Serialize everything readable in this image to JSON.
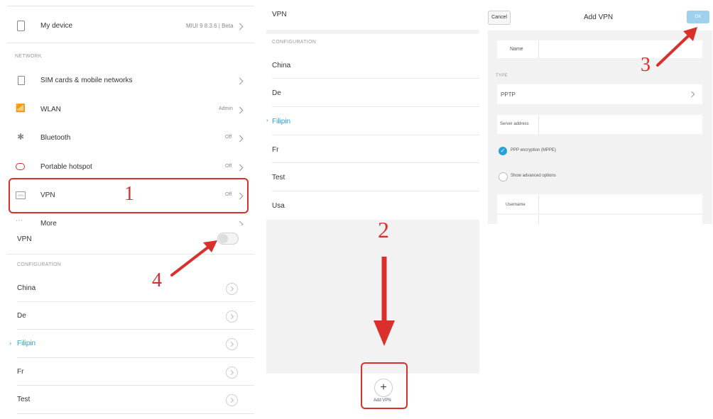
{
  "panel1": {
    "my_device": {
      "label": "My device",
      "value": "MIUI 9 8.3.6 | Beta"
    },
    "network_header": "NETWORK",
    "items": [
      {
        "label": "SIM cards & mobile networks",
        "value": ""
      },
      {
        "label": "WLAN",
        "value": "Admin"
      },
      {
        "label": "Bluetooth",
        "value": "Off"
      },
      {
        "label": "Portable hotspot",
        "value": "Off"
      },
      {
        "label": "VPN",
        "value": "Off"
      },
      {
        "label": "More",
        "value": ""
      }
    ],
    "vpn_icon_text": "VPN"
  },
  "panel4": {
    "vpn_label": "VPN",
    "vpn_toggle": "off",
    "config_header": "CONFIGURATION",
    "configs": [
      "China",
      "De",
      "Filipin",
      "Fr",
      "Test"
    ],
    "active_config": "Filipin"
  },
  "panel2": {
    "title": "VPN",
    "config_header": "CONFIGURATION",
    "configs": [
      "China",
      "De",
      "Filipin",
      "Fr",
      "Test",
      "Usa"
    ],
    "active_config": "Filipin",
    "add_button_label": "Add VPN"
  },
  "panel3": {
    "cancel_label": "Cancel",
    "title": "Add VPN",
    "ok_label": "OK",
    "name_label": "Name",
    "type_header": "TYPE",
    "type_value": "PPTP",
    "server_label": "Server address",
    "ppp_label": "PPP encryption (MPPE)",
    "ppp_checked": true,
    "advanced_label": "Show advanced options",
    "username_label": "Username"
  },
  "annotations": [
    "1",
    "2",
    "3",
    "4"
  ],
  "colors": {
    "accent": "#2a9fd8",
    "annotation_red": "#d9302c",
    "ok_button": "#9fd0ee"
  }
}
